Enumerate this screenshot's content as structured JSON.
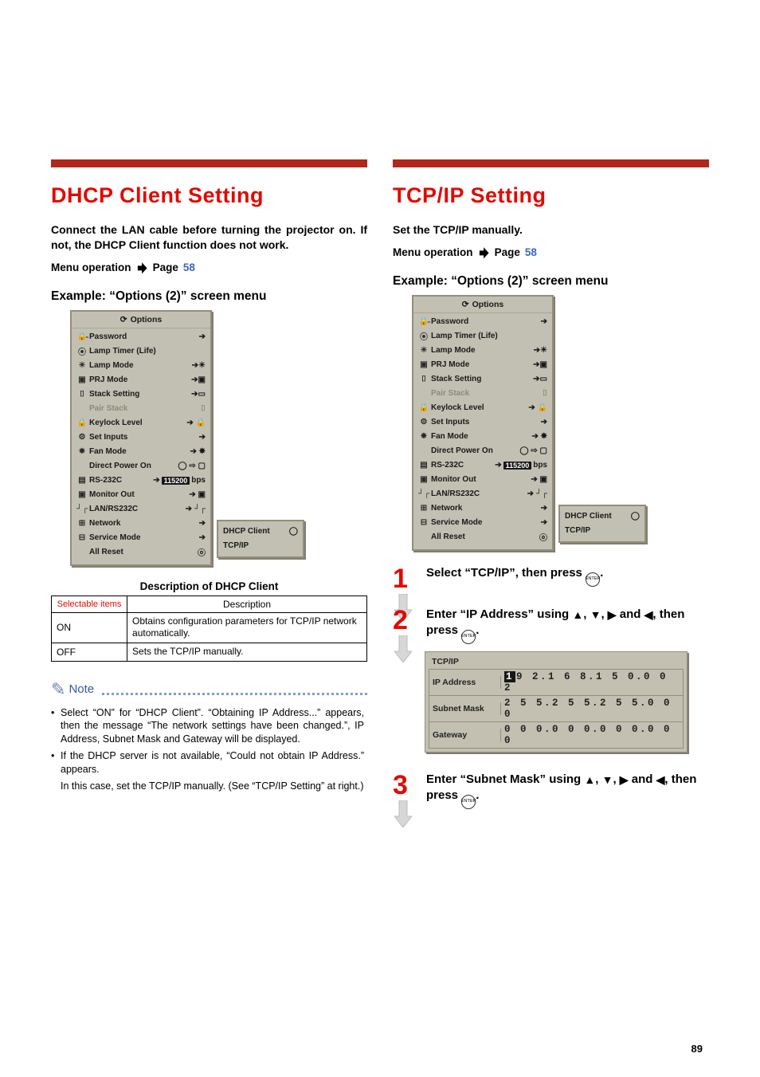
{
  "left": {
    "heading": "DHCP Client Setting",
    "intro": "Connect the LAN cable before turning the projector on. If not, the DHCP Client function does not work.",
    "menuop_label": "Menu operation",
    "menuop_page_prefix": "Page",
    "menuop_page_num": "58",
    "example_label": "Example: “Options (2)” screen menu",
    "desc_title": "Description of DHCP Client",
    "table": {
      "head_sel": "Selectable items",
      "head_desc": "Description",
      "rows": [
        {
          "sel": "ON",
          "desc": "Obtains configuration parameters for TCP/IP network automatically."
        },
        {
          "sel": "OFF",
          "desc": "Sets the TCP/IP manually."
        }
      ]
    },
    "note": {
      "label": "Note",
      "items": [
        "Select “ON” for “DHCP Client”. “Obtaining IP Address...” appears, then the message “The network settings have been changed.”, IP Address, Subnet Mask and Gateway will be displayed.",
        "If the DHCP server is not available, “Could not obtain IP Address.” appears."
      ],
      "continuation": "In this case, set the TCP/IP manually. (See “TCP/IP Setting” at right.)"
    }
  },
  "right": {
    "heading": "TCP/IP Setting",
    "intro": "Set the TCP/IP manually.",
    "menuop_label": "Menu operation",
    "menuop_page_prefix": "Page",
    "menuop_page_num": "58",
    "example_label": "Example: “Options (2)” screen menu",
    "steps": {
      "s1_num": "1",
      "s1_text_a": "Select “TCP/IP”, then press ",
      "s1_text_b": ".",
      "s2_num": "2",
      "s2_text_a": "Enter “IP Address” using ",
      "s2_text_mid": " and ",
      "s2_text_b": ", then press ",
      "s2_text_c": ".",
      "s3_num": "3",
      "s3_text_a": "Enter “Subnet Mask” using ",
      "s3_text_mid": " and ",
      "s3_text_b": ", then press ",
      "s3_text_c": "."
    },
    "tcp": {
      "title": "TCP/IP",
      "rows": [
        {
          "k": "IP Address",
          "v_first": "1",
          "v_rest": "9 2.1 6 8.1 5 0.0 0 2"
        },
        {
          "k": "Subnet Mask",
          "v_first": "",
          "v_rest": "2 5 5.2 5 5.2 5 5.0 0 0"
        },
        {
          "k": "Gateway",
          "v_first": "",
          "v_rest": "0 0 0.0 0 0.0 0 0.0 0 0"
        }
      ]
    }
  },
  "options_screen": {
    "title": "Options",
    "rows": [
      {
        "icon": "🔒̵",
        "label": "Password",
        "val": "➔"
      },
      {
        "icon": "⦿",
        "label": "Lamp Timer (Life)",
        "val": ""
      },
      {
        "icon": "☀",
        "label": "Lamp Mode",
        "val": "➔☀"
      },
      {
        "icon": "▣",
        "label": "PRJ Mode",
        "val": "➔▣"
      },
      {
        "icon": "⌷",
        "label": "Stack Setting",
        "val": "➔▭"
      },
      {
        "icon": "",
        "label": "Pair Stack",
        "val": "⌷",
        "dim": true
      },
      {
        "icon": "🔒",
        "label": "Keylock Level",
        "val": "➔ 🔒"
      },
      {
        "icon": "⚙",
        "label": "Set Inputs",
        "val": "➔"
      },
      {
        "icon": "✸",
        "label": "Fan Mode",
        "val": "➔ ✸"
      },
      {
        "icon": "",
        "label": "Direct Power On",
        "val": "◯ ⇨ ▢"
      },
      {
        "icon": "▤",
        "label": "RS-232C",
        "val": "➔",
        "pill": "115200",
        "suffix": "bps"
      },
      {
        "icon": "▣",
        "label": "Monitor Out",
        "val": "➔ ▣"
      },
      {
        "icon": "┘┌",
        "label": "LAN/RS232C",
        "val": "➔ ┘┌"
      },
      {
        "icon": "⊞",
        "label": "Network",
        "val": "➔"
      },
      {
        "icon": "⊟",
        "label": "Service Mode",
        "val": "➔"
      },
      {
        "icon": "",
        "label": "All Reset",
        "val": "ⓞ"
      }
    ],
    "sub": {
      "dhcp_label": "DHCP Client",
      "dhcp_val": "◯",
      "tcp_label": "TCP/IP"
    }
  },
  "page_number": "89"
}
